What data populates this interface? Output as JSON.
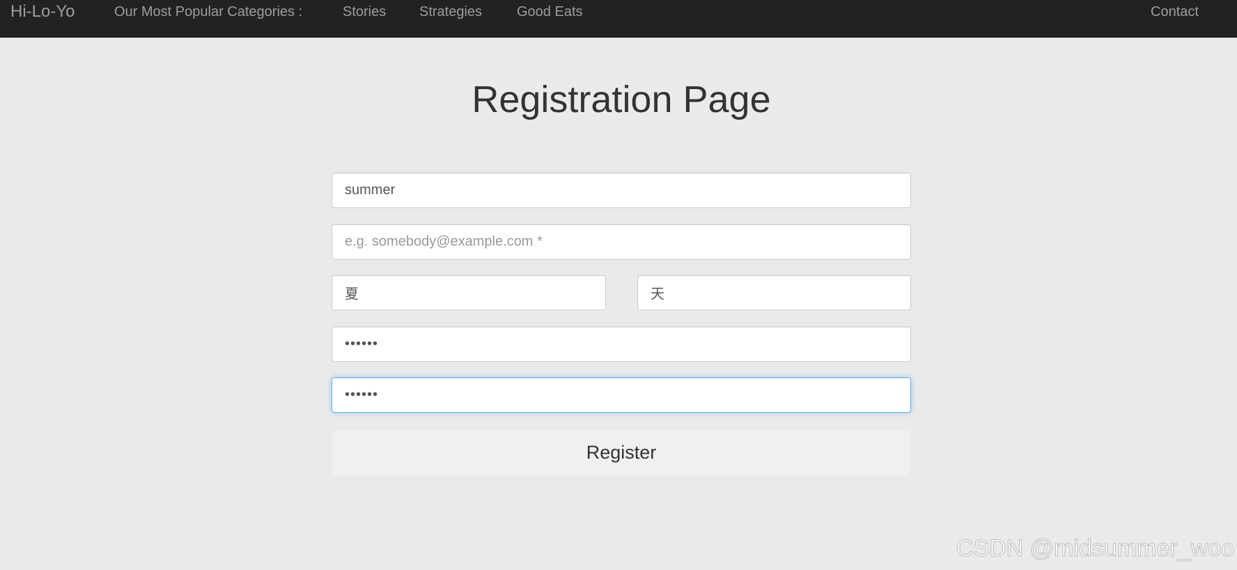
{
  "navbar": {
    "brand": "Hi-Lo-Yo",
    "categories_label": "Our Most Popular Categories :",
    "links": [
      "Stories",
      "Strategies",
      "Good Eats"
    ],
    "contact": "Contact"
  },
  "page": {
    "title": "Registration Page"
  },
  "form": {
    "username_value": "summer",
    "email_value": "",
    "email_placeholder": "e.g. somebody@example.com *",
    "first_name_value": "夏",
    "last_name_value": "天",
    "password_value": "••••••",
    "confirm_password_value": "••••••",
    "register_label": "Register"
  },
  "watermark": "CSDN @midsummer_woo",
  "colors": {
    "navbar_bg": "#222222",
    "navbar_text": "#9d9d9d",
    "page_bg": "#eaeaea",
    "focus_border": "#66afe9"
  }
}
